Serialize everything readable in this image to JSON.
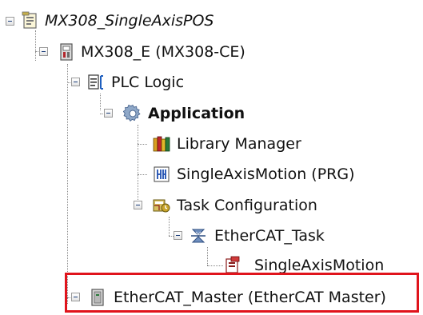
{
  "tree": {
    "nodes": [
      {
        "id": "project",
        "label": "MX308_SingleAxisPOS",
        "icon": "project-icon"
      },
      {
        "id": "device",
        "label": "MX308_E (MX308-CE)",
        "icon": "device-icon"
      },
      {
        "id": "plc-logic",
        "label": "PLC Logic",
        "icon": "plc-logic-icon"
      },
      {
        "id": "application",
        "label": "Application",
        "icon": "gear-icon"
      },
      {
        "id": "library-manager",
        "label": "Library Manager",
        "icon": "books-icon"
      },
      {
        "id": "program",
        "label": "SingleAxisMotion (PRG)",
        "icon": "program-icon"
      },
      {
        "id": "task-configuration",
        "label": "Task Configuration",
        "icon": "task-config-icon"
      },
      {
        "id": "ethercat-task",
        "label": "EtherCAT_Task",
        "icon": "task-icon"
      },
      {
        "id": "task-call",
        "label": "SingleAxisMotion",
        "icon": "call-icon"
      },
      {
        "id": "ethercat-master",
        "label": "EtherCAT_Master (EtherCAT Master)",
        "icon": "master-device-icon"
      }
    ]
  },
  "highlight": {
    "color": "#e0141c"
  }
}
